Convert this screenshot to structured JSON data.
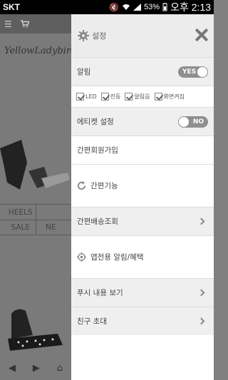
{
  "statusbar": {
    "carrier": "SKT",
    "battery": "53%",
    "time": "오후 2:13"
  },
  "background": {
    "logo": "YellowLadybird",
    "table": {
      "row1": [
        "HEELS",
        ""
      ],
      "row2": [
        "SALE",
        "NE"
      ]
    }
  },
  "drawer": {
    "header_title": "설정",
    "alarm_label": "알림",
    "alarm_toggle": "YES",
    "checks": [
      "LED",
      "진동",
      "알림음",
      "화면켜짐"
    ],
    "etiquette_label": "에티켓 설정",
    "etiquette_toggle": "NO",
    "simple_join": "간편회원가입",
    "simple_func": "간편기능",
    "delivery": "간편배송조회",
    "app_alarm": "앱전용 알림/혜택",
    "push_view": "푸시 내용 보기",
    "invite": "친구 초대"
  }
}
